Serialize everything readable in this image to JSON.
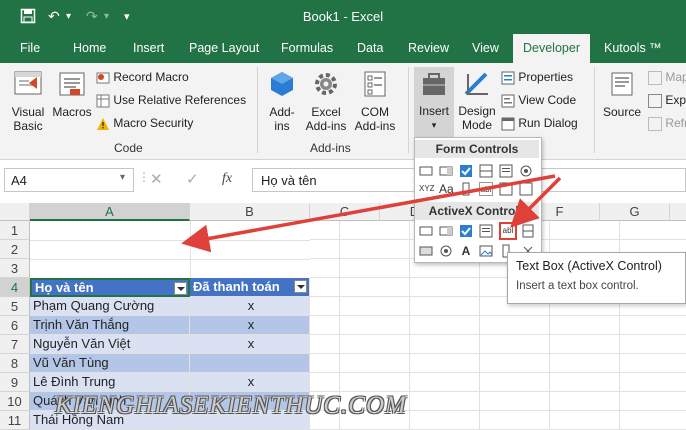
{
  "app": {
    "title": "Book1  -  Excel"
  },
  "tabs": [
    "File",
    "Home",
    "Insert",
    "Page Layout",
    "Formulas",
    "Data",
    "Review",
    "View",
    "Developer",
    "Kutools ™"
  ],
  "active_tab": "Developer",
  "ribbon": {
    "code": {
      "visual_basic": [
        "Visual",
        "Basic"
      ],
      "macros": "Macros",
      "record_macro": "Record Macro",
      "use_relative": "Use Relative References",
      "macro_security": "Macro Security",
      "group": "Code"
    },
    "addins": {
      "addins_btn": [
        "Add-",
        "ins"
      ],
      "excel_addins": [
        "Excel",
        "Add-ins"
      ],
      "com_addins": [
        "COM",
        "Add-ins"
      ],
      "group": "Add-ins"
    },
    "controls": {
      "insert": "Insert",
      "design_mode": [
        "Design",
        "Mode"
      ],
      "properties": "Properties",
      "view_code": "View Code",
      "run_dialog": "Run Dialog"
    },
    "xml": {
      "source": "Source",
      "map": "Map",
      "expand": "Expa",
      "refresh": "Refr"
    }
  },
  "formula_bar": {
    "cell_ref": "A4",
    "fx": "fx",
    "content": "Họ và tên"
  },
  "columns": [
    "A",
    "B",
    "C",
    "D",
    "E",
    "F",
    "G"
  ],
  "rows": [
    "1",
    "2",
    "3",
    "4",
    "5",
    "6",
    "7",
    "8",
    "9",
    "10",
    "11"
  ],
  "table": {
    "headers": [
      "Họ và tên",
      "Đã thanh toán"
    ],
    "names": [
      "Phạm Quang Cường",
      "Trịnh Văn Thắng",
      "Nguyễn Văn Việt",
      "Vũ Văn Tùng",
      "Lê Đình Trung",
      "Quách Văn Linh",
      "Thái Hồng Nam"
    ],
    "paid": [
      "x",
      "x",
      "x",
      "",
      "x",
      "",
      ""
    ]
  },
  "insert_menu": {
    "form_controls": "Form Controls",
    "activex_controls": "ActiveX Controls"
  },
  "tooltip": {
    "title": "Text Box (ActiveX Control)",
    "desc": "Insert a text box control."
  },
  "watermark": "KIENGHIASEKIENTHUC.COM",
  "colors": {
    "excel_green": "#217346",
    "table_header": "#4472c4",
    "band_light": "#d9e1f2",
    "band_dark": "#b4c6e7",
    "arrow": "#e0403a"
  }
}
